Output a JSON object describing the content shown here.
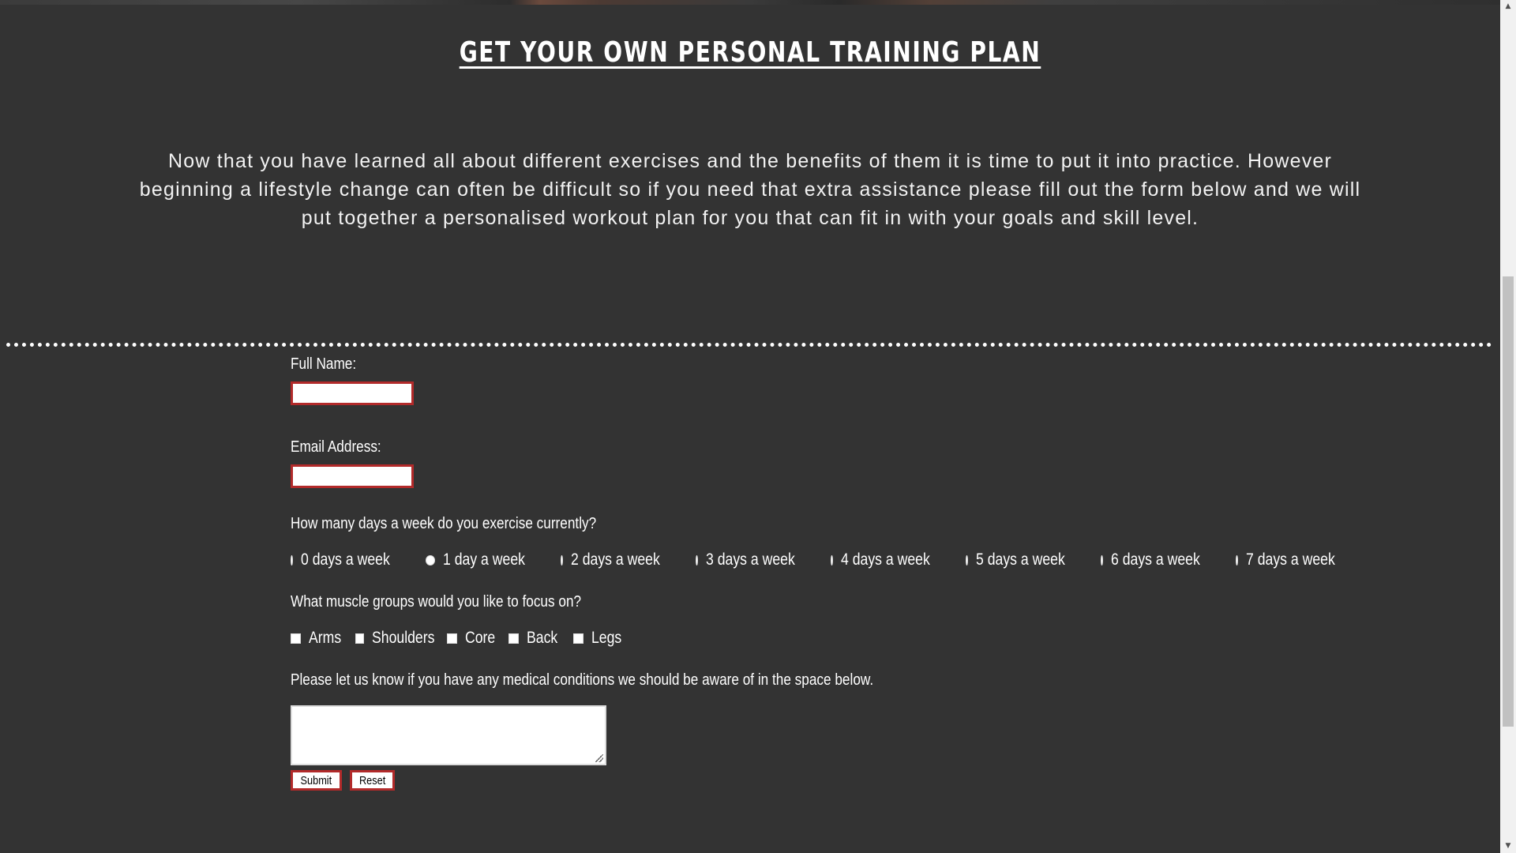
{
  "heading": "GET YOUR OWN PERSONAL TRAINING PLAN",
  "intro": "Now that you have learned all about different exercises and the benefits of them it is time to put it into practice. However beginning a lifestyle change can often be difficult so if you need that extra assistance please fill out the form below and we will put together a personalised workout plan for you that can fit in with your goals and skill level.",
  "form": {
    "name_label": "Full Name:",
    "name_value": "",
    "email_label": "Email Address:",
    "email_value": "",
    "days_question": "How many days a week do you exercise currently?",
    "days_options": [
      "0 days a week",
      "1 day a week",
      "2 days a week",
      "3 days a week",
      "4 days a week",
      "5 days a week",
      "6 days a week",
      "7 days a week"
    ],
    "muscle_question": "What muscle groups would you like to focus on?",
    "muscle_options": [
      "Arms",
      "Shoulders",
      "Core",
      "Back",
      "Legs"
    ],
    "medical_question": "Please let us know if you have any medical conditions we should be aware of in the space below.",
    "medical_value": "",
    "submit_label": "Submit",
    "reset_label": "Reset"
  },
  "colors": {
    "background": "#333333",
    "input_border": "#b22a2a",
    "text": "#ffffff"
  },
  "scrollbar": {
    "up_icon": "triangle-up-icon",
    "down_icon": "triangle-down-icon"
  }
}
